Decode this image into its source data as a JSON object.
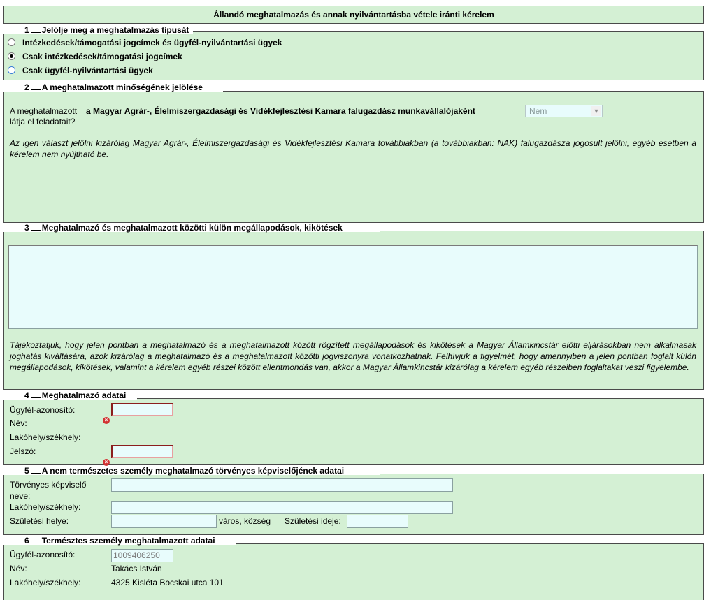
{
  "title": "Állandó meghatalmazás és annak nyilvántartásba vétele iránti kérelem",
  "s1": {
    "num": "1",
    "legend": "Jelölje meg a meghatalmazás típusát",
    "options": [
      {
        "label": "Intézkedések/támogatási jogcímek és ügyfél-nyilvántartási ügyek",
        "checked": false
      },
      {
        "label": "Csak intézkedések/támogatási jogcímek",
        "checked": true
      },
      {
        "label": "Csak ügyfél-nyilvántartási ügyek",
        "checked": false
      }
    ]
  },
  "s2": {
    "num": "2",
    "legend": "A meghatalmazott minőségének jelölése",
    "q_prefix": "A meghatalmazott",
    "q_bold": "a Magyar Agrár-, Élelmiszergazdasági és Vidékfejlesztési Kamara falugazdász munkavállalójaként",
    "q_line2": "látja el feladatait?",
    "select_value": "Nem",
    "note": "Az igen választ jelölni kizárólag Magyar Agrár-, Élelmiszergazdasági és Vidékfejlesztési Kamara továbbiakban (a továbbiakban: NAK) falugazdásza jogosult jelölni, egyéb esetben a kérelem nem nyújtható be."
  },
  "s3": {
    "num": "3",
    "legend": "Meghatalmazó és meghatalmazott közötti külön megállapodások, kikötések",
    "textarea_value": "",
    "note": "Tájékoztatjuk, hogy jelen pontban a meghatalmazó és a meghatalmazott között rögzített megállapodások és kikötések a Magyar Államkincstár előtti eljárásokban nem alkalmasak joghatás kiváltására, azok kizárólag a meghatalmazó és a meghatalmazott közötti jogviszonyra vonatkozhatnak. Felhívjuk a figyelmét, hogy amennyiben a jelen pontban foglalt külön megállapodások, kikötések, valamint a kérelem egyéb részei között ellentmondás van, akkor a Magyar Államkincstár kizárólag a kérelem egyéb részeiben foglaltakat veszi figyelembe."
  },
  "s4": {
    "num": "4",
    "legend": "Meghatalmazó adatai",
    "client_id_label": "Ügyfél-azonosító:",
    "client_id_value": "",
    "name_label": "Név:",
    "address_label": "Lakóhely/székhely:",
    "password_label": "Jelszó:",
    "password_value": ""
  },
  "s5": {
    "num": "5",
    "legend": "A nem természetes személy meghatalmazó törvényes képviselőjének adatai",
    "rep_label_1": "Törvényes képviselő",
    "rep_label_2": "neve:",
    "address_label": "Lakóhely/székhely:",
    "birthplace_label": "Születési helye:",
    "city_label": "város, község",
    "birthdate_label": "Születési ideje:",
    "rep_value": "",
    "address_value": "",
    "birthplace_value": "",
    "birthdate_value": ""
  },
  "s6": {
    "num": "6",
    "legend": "Természtes személy meghatalmazott adatai",
    "client_id_label": "Ügyfél-azonosító:",
    "client_id_value": "1009406250",
    "name_label": "Név:",
    "name_value": "Takács István",
    "address_label": "Lakóhely/székhely:",
    "address_value": "4325 Kisléta Bocskai utca 101"
  }
}
